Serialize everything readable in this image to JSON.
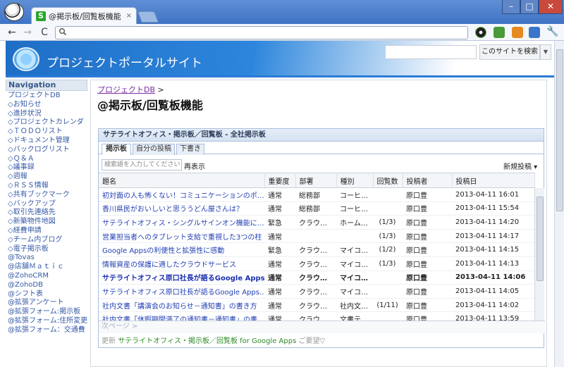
{
  "browser": {
    "tab_title": "@掲示板/回覧板機能 - [",
    "tab_favicon": "S",
    "tab_close": "×",
    "window_buttons": {
      "minimize": "–",
      "maximize": "□",
      "close": "✕"
    },
    "nav": {
      "back": "←",
      "forward": "→",
      "reload": "C"
    },
    "omnibox_value": ""
  },
  "site": {
    "title": "プロジェクトポータルサイト",
    "search_button": "このサイトを検索",
    "search_dropdown": "▼"
  },
  "leftnav": {
    "heading": "Navigation",
    "items": [
      "プロジェクトDB",
      "◇お知らせ",
      "◇進捗状況",
      "◇プロジェクトカレンダ",
      "◇ＴＯＤＯリスト",
      "◇ドキュメント管理",
      "◇バックログリスト",
      "◇Ｑ＆Ａ",
      "◇議事録",
      "◇週報",
      "◇ＲＳＳ情報",
      "◇共有ブックマーク",
      "◇バックアップ",
      "◇取引先連絡先",
      "◇新築物件地図",
      "◇経費申請",
      "◇チーム内ブログ",
      "◇電子掲示板",
      "@Tovas",
      "@店舗Ｍａｔｉｃ",
      "@ZohoCRM",
      "@ZohoDB",
      "@シフト表",
      "@拡張アンケート",
      "@拡張フォーム:掲示板",
      "@拡張フォーム:住所変更",
      "@拡張フォーム：交通費"
    ]
  },
  "main": {
    "breadcrumb": {
      "link": "プロジェクトDB",
      "separator": ">"
    },
    "page_title": "@掲示板/回覧板機能"
  },
  "board": {
    "title": "サテライトオフィス・掲示板／回覧板 - 全社掲示板",
    "tabs": [
      "掲示板",
      "自分の投稿",
      "下書き"
    ],
    "search_placeholder": "検索語を入力してください",
    "refresh": "再表示",
    "new_post": "新規投稿 ▾",
    "columns": [
      "題名",
      "重要度",
      "部署",
      "種別",
      "回覧数",
      "投稿者",
      "投稿日"
    ],
    "rows": [
      {
        "title": "初対面の人も怖くない！コミュニケーションのポ…",
        "priority": "通常",
        "dept": "総務部",
        "kind": "コーヒ…",
        "count": "",
        "author": "原口豊",
        "date": "2013-04-11 16:01",
        "bold": false
      },
      {
        "title": "香川県民がおいしいと思ううどん屋さんは？",
        "priority": "通常",
        "dept": "総務部",
        "kind": "コーヒ…",
        "count": "",
        "author": "原口豊",
        "date": "2013-04-11 15:54",
        "bold": false
      },
      {
        "title": "サテライトオフィス・シングルサインオン機能に…",
        "priority": "緊急",
        "dept": "クラウ…",
        "kind": "ホーム…",
        "count": "(1/3)",
        "author": "原口豊",
        "date": "2013-04-11 14:20",
        "bold": false
      },
      {
        "title": "営業担当者へのタブレット支給で重視した3つの柱",
        "priority": "通常",
        "dept": "",
        "kind": "",
        "count": "(1/3)",
        "author": "原口豊",
        "date": "2013-04-11 14:17",
        "bold": false
      },
      {
        "title": "Google Appsの利便性と拡張性に感動",
        "priority": "緊急",
        "dept": "クラウ…",
        "kind": "マイコ…",
        "count": "(1/2)",
        "author": "原口豊",
        "date": "2013-04-11 14:15",
        "bold": false
      },
      {
        "title": "情報資産の保護に適したクラウドサービス",
        "priority": "通常",
        "dept": "クラウ…",
        "kind": "マイコ…",
        "count": "(1/3)",
        "author": "原口豊",
        "date": "2013-04-11 14:13",
        "bold": false
      },
      {
        "title": "サテライトオフィス原口社長が語るGoogle Apps…",
        "priority": "通常",
        "dept": "クラウ…",
        "kind": "マイコ…",
        "count": "",
        "author": "原口豊",
        "date": "2013-04-11 14:06",
        "bold": true
      },
      {
        "title": "サテライトオフィス原口社長が語るGoogle Apps…",
        "priority": "通常",
        "dept": "クラウ…",
        "kind": "マイコ…",
        "count": "",
        "author": "原口豊",
        "date": "2013-04-11 14:05",
        "bold": false
      },
      {
        "title": "社内文書「講演会のお知らせ－通知書」の書き方",
        "priority": "通常",
        "dept": "クラウ…",
        "kind": "社内文…",
        "count": "(1/11)",
        "author": "原口豊",
        "date": "2013-04-11 14:02",
        "bold": false
      },
      {
        "title": "社内文書「休暇期間満了の通知書－通知書」の書…",
        "priority": "通常",
        "dept": "クラウ…",
        "kind": "文書テ…",
        "count": "",
        "author": "原口豊",
        "date": "2013-04-11 13:59",
        "bold": false
      }
    ],
    "pager": "次ページ >",
    "footer": {
      "refresh": "更新",
      "app_name": "サテライトオフィス・掲示板／回覧板 for Google Apps",
      "feedback": "ご要望▽"
    }
  }
}
